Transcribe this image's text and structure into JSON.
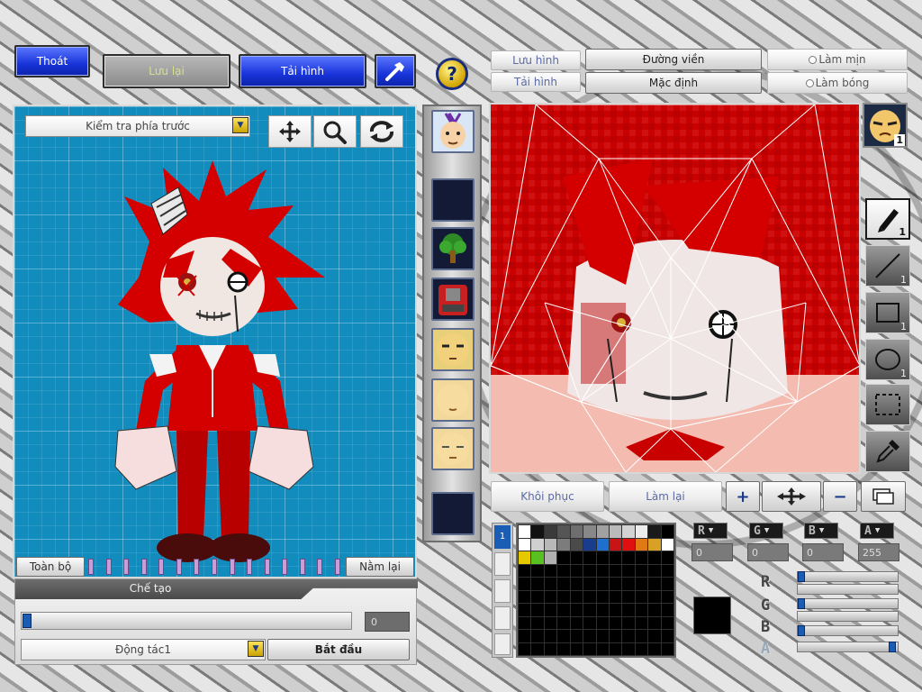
{
  "top_left": {
    "exit_label": "Thoát",
    "save_label": "Lưu lại",
    "reload_label": "Tải hình"
  },
  "top_right": {
    "save_image_label": "Lưu hình",
    "load_image_label": "Tải hình",
    "outline_label": "Đường viền",
    "default_label": "Mặc định",
    "smooth_label": "Làm mịn",
    "shine_label": "Làm bóng"
  },
  "preview": {
    "view_select_value": "Kiểm tra phía trước",
    "full_label": "Toàn bộ",
    "lie_down_label": "Nằm lại"
  },
  "create_panel": {
    "title": "Chế tạo",
    "frame_value": "0",
    "action_select_value": "Động tác1",
    "start_label": "Bắt đầu"
  },
  "editor": {
    "restore_label": "Khôi phục",
    "redo_label": "Làm lại",
    "character_badge": "1",
    "tool_counts": [
      "1",
      "1",
      "1",
      "1"
    ]
  },
  "color": {
    "r_label": "R",
    "g_label": "G",
    "b_label": "B",
    "a_label": "A",
    "r_value": "0",
    "g_value": "0",
    "b_value": "0",
    "a_value": "255",
    "r_fraction": 0.0,
    "g_fraction": 0.0,
    "b_fraction": 0.0,
    "a_fraction": 1.0,
    "palette_row1": [
      "#ffffff",
      "#111111",
      "#3a3a3a",
      "#555555",
      "#6e6e6e",
      "#888888",
      "#a1a1a1",
      "#bababa",
      "#d3d3d3",
      "#ececec",
      "#1a1a1a",
      "#000000"
    ],
    "palette_row2": [
      "#ffffff",
      "#d0d0d0",
      "#b8b8b8",
      "#7c7c7c",
      "#4a4a4a",
      "#1a3c8c",
      "#1f6fd0",
      "#c81414",
      "#e01010",
      "#e07814",
      "#d8a024",
      "#ffffff"
    ],
    "palette_row3": [
      "#e6c800",
      "#58c020",
      "#b0b0b0"
    ],
    "palette_tab": "1"
  }
}
